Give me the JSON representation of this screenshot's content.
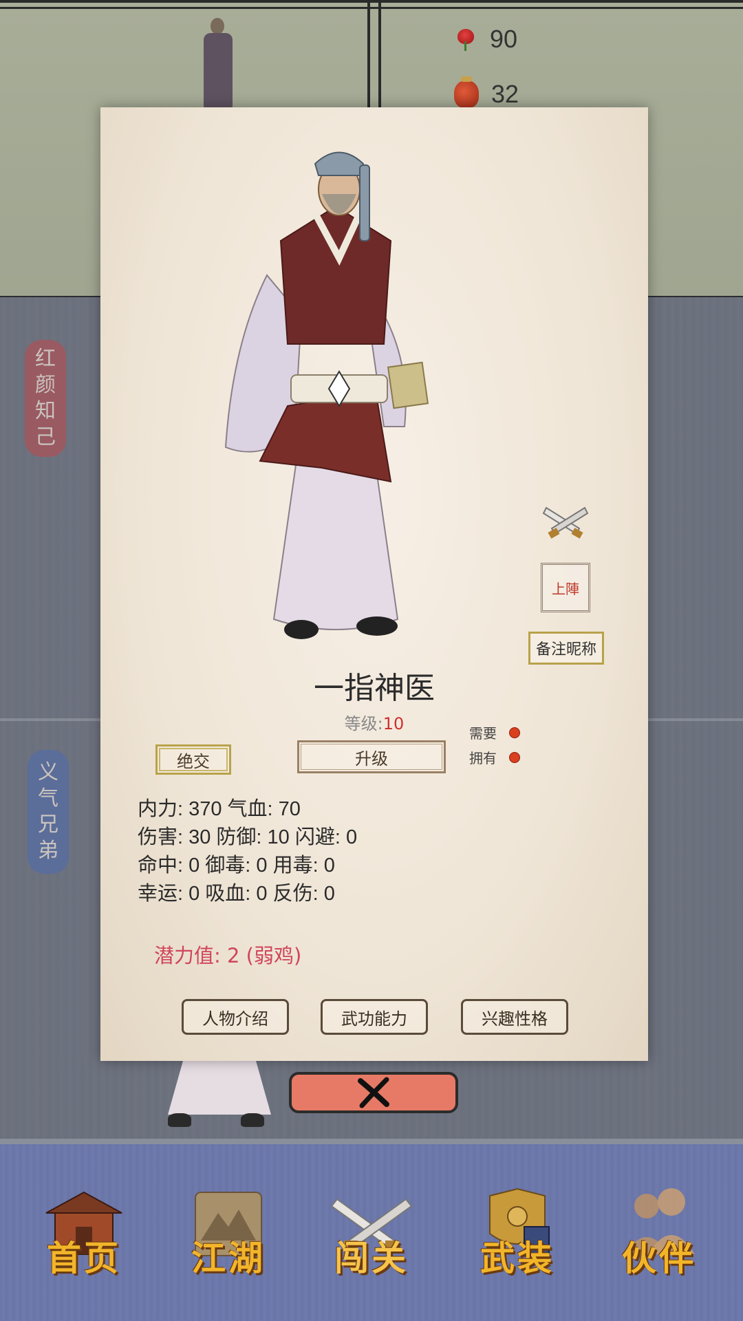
{
  "resources": [
    {
      "icon": "rose-icon",
      "value": "90"
    },
    {
      "icon": "wine-jar-icon",
      "value": "32"
    }
  ],
  "side_tabs": {
    "confidante": [
      "红",
      "颜",
      "知",
      "己"
    ],
    "brothers": [
      "义",
      "气",
      "兄",
      "弟"
    ]
  },
  "character": {
    "name": "一指神医",
    "level_label": "等级:",
    "level": "10",
    "sever_label": "绝交",
    "upgrade_label": "升级",
    "require_label": "需要",
    "own_label": "拥有",
    "deploy_label": "上陣",
    "nickname_label": "备注昵称",
    "stats": [
      "内力: 370 气血: 70",
      "伤害: 30 防御: 10 闪避: 0",
      "命中: 0 御毒: 0 用毒: 0",
      "幸运: 0 吸血: 0 反伤: 0"
    ],
    "potential": "潜力值:  2 (弱鸡)",
    "tabs": [
      "人物介绍",
      "武功能力",
      "兴趣性格"
    ]
  },
  "nav": [
    {
      "label": "首页",
      "icon": "home-house-icon"
    },
    {
      "label": "江湖",
      "icon": "scroll-map-icon"
    },
    {
      "label": "闯关",
      "icon": "crossed-swords-icon"
    },
    {
      "label": "武装",
      "icon": "armor-icon"
    },
    {
      "label": "伙伴",
      "icon": "partners-icon"
    }
  ],
  "colors": {
    "level_number": "#d0302c",
    "potential": "#d0455a",
    "nav_label": "#f2b52a",
    "close_button": "#e77a66"
  }
}
